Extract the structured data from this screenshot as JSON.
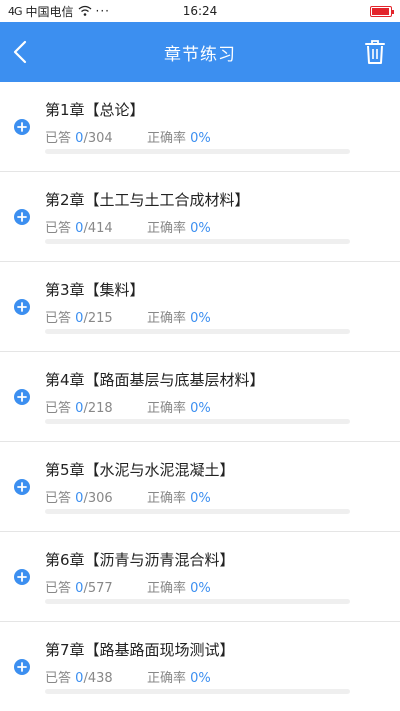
{
  "statusbar": {
    "signal": "4G",
    "carrier": "中国电信",
    "more": "···",
    "time": "16:24",
    "battery_level": 0.95,
    "battery_color": "#e3242b"
  },
  "navbar": {
    "title": "章节练习",
    "back_icon": "chevron-left-icon",
    "trash_icon": "trash-icon",
    "color": "#3c8ff0"
  },
  "labels": {
    "answered": "已答",
    "accuracy": "正确率"
  },
  "chapters": [
    {
      "title": "第1章【总论】",
      "answered": "0",
      "total": "/304",
      "accuracy": "0%",
      "progress": 0
    },
    {
      "title": "第2章【土工与土工合成材料】",
      "answered": "0",
      "total": "/414",
      "accuracy": "0%",
      "progress": 0
    },
    {
      "title": "第3章【集料】",
      "answered": "0",
      "total": "/215",
      "accuracy": "0%",
      "progress": 0
    },
    {
      "title": "第4章【路面基层与底基层材料】",
      "answered": "0",
      "total": "/218",
      "accuracy": "0%",
      "progress": 0
    },
    {
      "title": "第5章【水泥与水泥混凝土】",
      "answered": "0",
      "total": "/306",
      "accuracy": "0%",
      "progress": 0
    },
    {
      "title": "第6章【沥青与沥青混合料】",
      "answered": "0",
      "total": "/577",
      "accuracy": "0%",
      "progress": 0
    },
    {
      "title": "第7章【路基路面现场测试】",
      "answered": "0",
      "total": "/438",
      "accuracy": "0%",
      "progress": 0
    }
  ]
}
